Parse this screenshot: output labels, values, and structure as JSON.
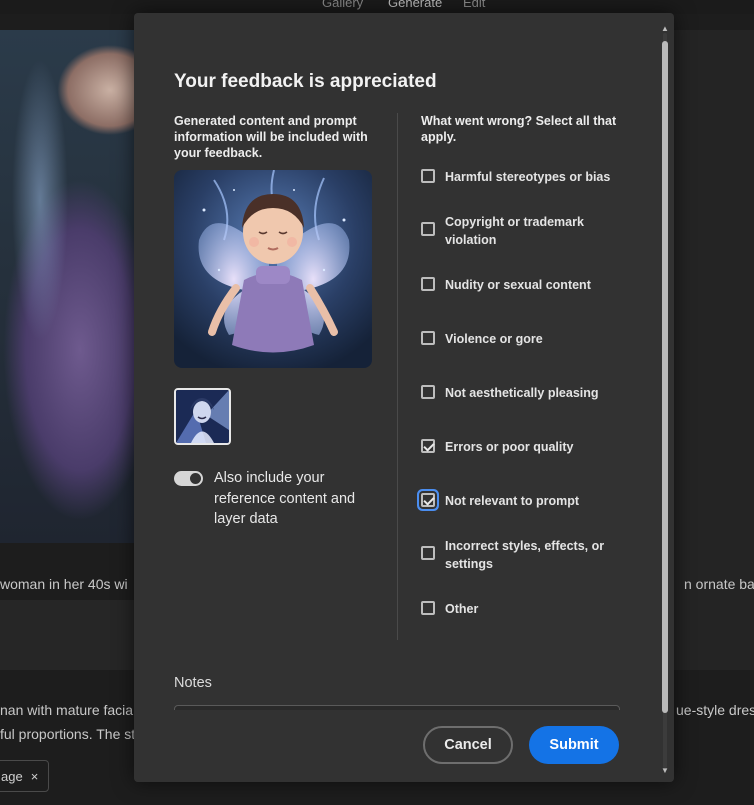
{
  "app_nav": {
    "gallery": "Gallery",
    "generate": "Generate",
    "edit": "Edit"
  },
  "background": {
    "left_caption": "woman in her 40s wi",
    "right_caption": "n ornate baro",
    "left_desc_line1": "nan with mature facia",
    "left_desc_line2": "ful proportions. The st",
    "right_desc_line1": "ue-style dres",
    "chip_label": "age",
    "chip_close": "×"
  },
  "modal": {
    "title": "Your feedback is appreciated",
    "note": "Generated content and prompt information will be included with your feedback.",
    "toggle_label": "Also include your reference content and layer data",
    "toggle_on": true,
    "question": "What went wrong? Select all that apply.",
    "options": [
      {
        "label": "Harmful stereotypes or bias",
        "checked": false
      },
      {
        "label": "Copyright or trademark violation",
        "checked": false
      },
      {
        "label": "Nudity or sexual content",
        "checked": false
      },
      {
        "label": "Violence or gore",
        "checked": false
      },
      {
        "label": "Not aesthetically pleasing",
        "checked": false
      },
      {
        "label": "Errors or poor quality",
        "checked": true
      },
      {
        "label": "Not relevant to prompt",
        "checked": true
      },
      {
        "label": "Incorrect styles, effects, or settings",
        "checked": false
      },
      {
        "label": "Other",
        "checked": false
      }
    ],
    "notes_label": "Notes",
    "cancel_label": "Cancel",
    "submit_label": "Submit"
  },
  "colors": {
    "accent": "#1473e6",
    "focus_ring": "#4b8ef0",
    "modal_bg": "#323232"
  }
}
